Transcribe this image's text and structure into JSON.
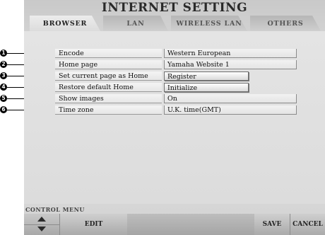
{
  "title": "INTERNET SETTING",
  "tabs": [
    {
      "label": "BROWSER",
      "active": true
    },
    {
      "label": "LAN",
      "active": false
    },
    {
      "label": "WIRELESS LAN",
      "active": false
    },
    {
      "label": "OTHERS",
      "active": false
    }
  ],
  "settings": [
    {
      "callout": "1",
      "label": "Encode",
      "value": "Western European",
      "kind": "value"
    },
    {
      "callout": "2",
      "label": "Home page",
      "value": "Yamaha Website 1",
      "kind": "value"
    },
    {
      "callout": "3",
      "label": "Set current page as Home",
      "value": "Register",
      "kind": "button"
    },
    {
      "callout": "4",
      "label": "Restore default Home",
      "value": "Initialize",
      "kind": "button"
    },
    {
      "callout": "5",
      "label": "Show images",
      "value": "On",
      "kind": "value"
    },
    {
      "callout": "6",
      "label": "Time zone",
      "value": "U.K. time(GMT)",
      "kind": "value"
    }
  ],
  "control_menu": {
    "label": "CONTROL MENU",
    "edit": "EDIT",
    "save": "SAVE",
    "cancel": "CANCEL"
  }
}
